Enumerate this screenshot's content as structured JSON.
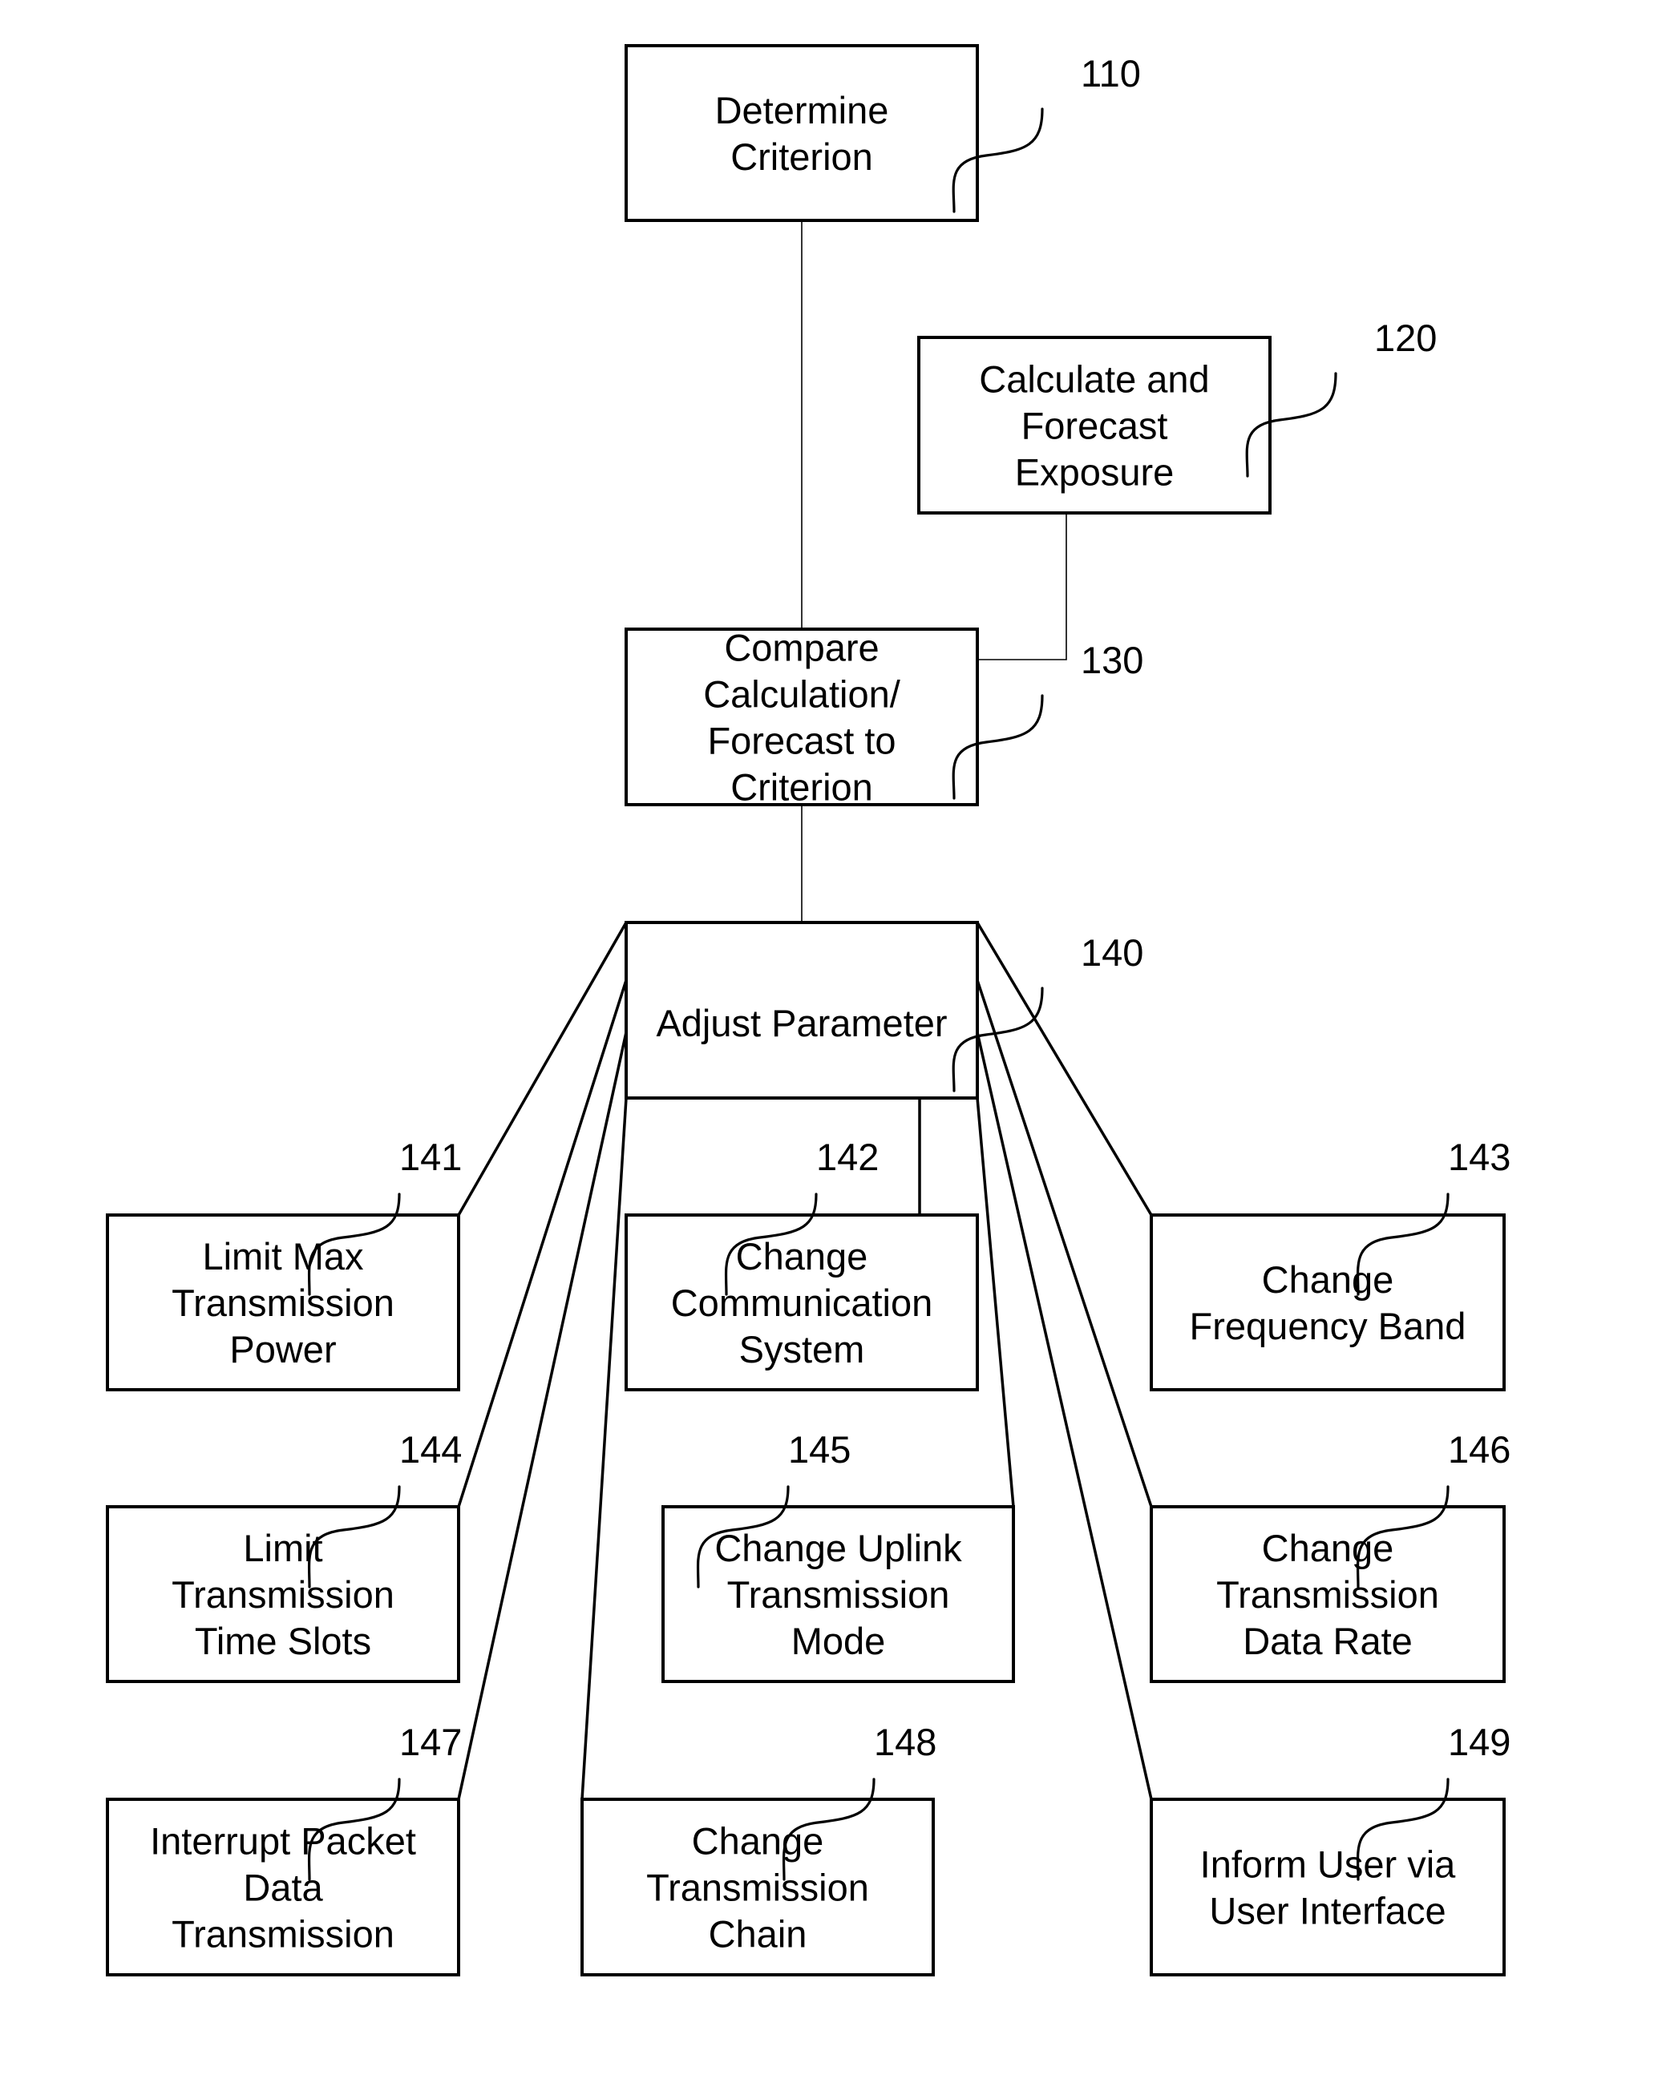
{
  "figure": {
    "steps": [
      {
        "id": "110",
        "ref": "110",
        "lines": [
          "Determine",
          "Criterion"
        ]
      },
      {
        "id": "120",
        "ref": "120",
        "lines": [
          "Calculate and",
          "Forecast",
          "Exposure"
        ]
      },
      {
        "id": "130",
        "ref": "130",
        "lines": [
          "Compare",
          "Calculation/",
          "Forecast to",
          "Criterion"
        ]
      },
      {
        "id": "140",
        "ref": "140",
        "lines": [
          "Adjust Parameter"
        ]
      }
    ],
    "options": [
      {
        "id": "141",
        "ref": "141",
        "lines": [
          "Limit Max",
          "Transmission",
          "Power"
        ]
      },
      {
        "id": "142",
        "ref": "142",
        "lines": [
          "Change",
          "Communication",
          "System"
        ]
      },
      {
        "id": "143",
        "ref": "143",
        "lines": [
          "Change",
          "Frequency Band"
        ]
      },
      {
        "id": "144",
        "ref": "144",
        "lines": [
          "Limit",
          "Transmission",
          "Time Slots"
        ]
      },
      {
        "id": "145",
        "ref": "145",
        "lines": [
          "Change Uplink",
          "Transmission",
          "Mode"
        ]
      },
      {
        "id": "146",
        "ref": "146",
        "lines": [
          "Change",
          "Transmission",
          "Data Rate"
        ]
      },
      {
        "id": "147",
        "ref": "147",
        "lines": [
          "Interrupt Packet",
          "Data",
          "Transmission"
        ]
      },
      {
        "id": "148",
        "ref": "148",
        "lines": [
          "Change",
          "Transmission",
          "Chain"
        ]
      },
      {
        "id": "149",
        "ref": "149",
        "lines": [
          "Inform User via",
          "User Interface"
        ]
      }
    ],
    "edges": [
      {
        "from": "110",
        "to": "130"
      },
      {
        "from": "120",
        "to": "130"
      },
      {
        "from": "130",
        "to": "140"
      },
      {
        "from": "140",
        "to": "141"
      },
      {
        "from": "140",
        "to": "142"
      },
      {
        "from": "140",
        "to": "143"
      },
      {
        "from": "140",
        "to": "144"
      },
      {
        "from": "140",
        "to": "145"
      },
      {
        "from": "140",
        "to": "146"
      },
      {
        "from": "140",
        "to": "147"
      },
      {
        "from": "140",
        "to": "148"
      },
      {
        "from": "140",
        "to": "149"
      }
    ]
  }
}
